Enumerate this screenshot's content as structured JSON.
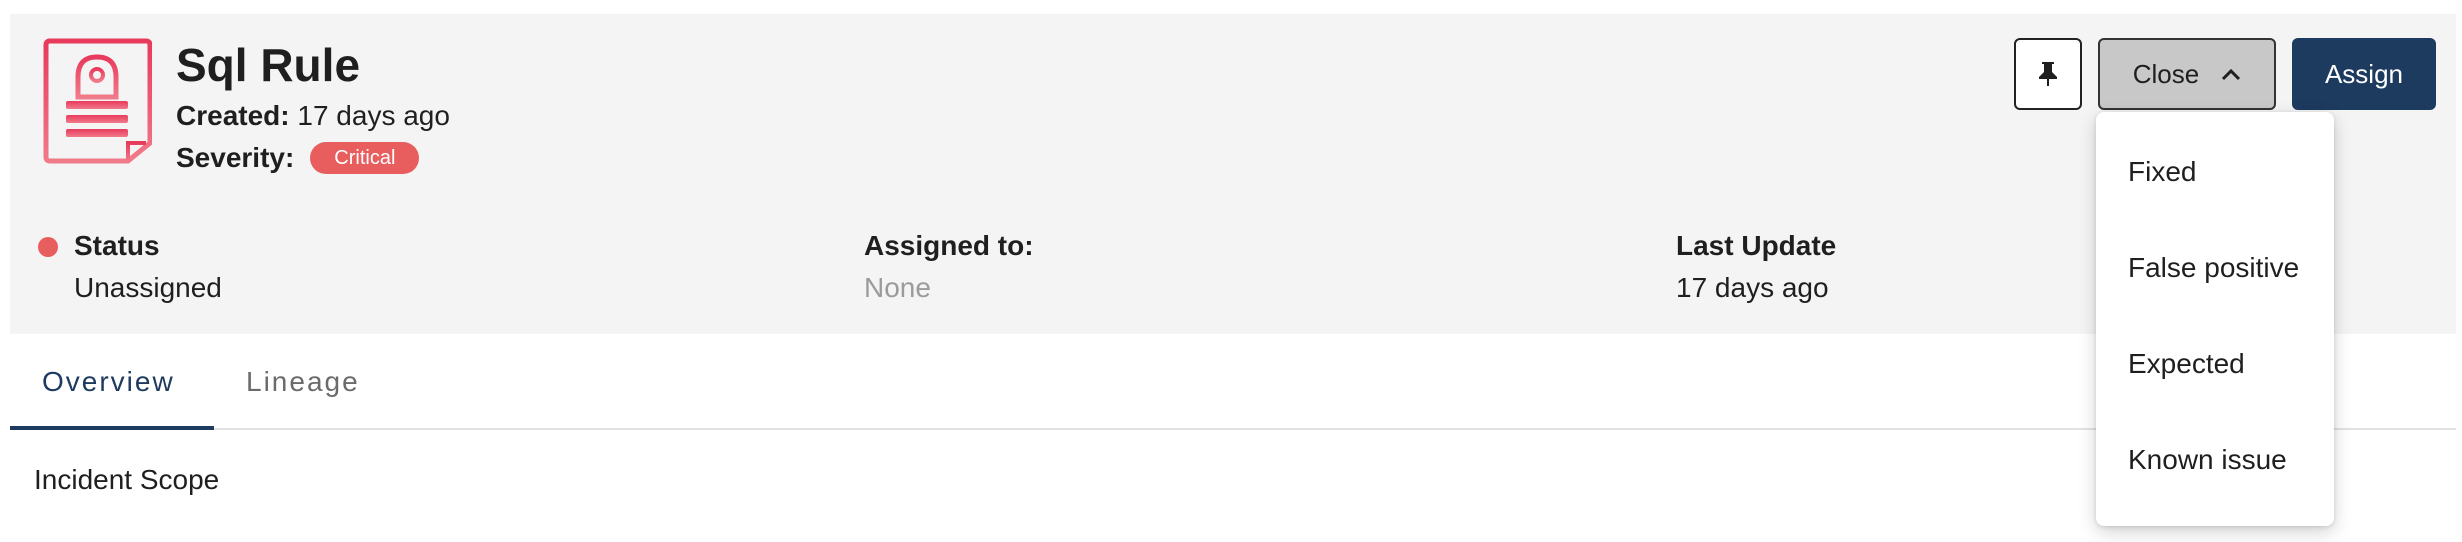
{
  "incident": {
    "title": "Sql Rule",
    "created_label": "Created:",
    "created_value": "17 days ago",
    "severity_label": "Severity:",
    "severity_value": "Critical",
    "icon": "alarm-siren-icon"
  },
  "actions": {
    "pin_icon": "pin-icon",
    "close_label": "Close",
    "close_chevron_icon": "chevron-up-icon",
    "assign_label": "Assign"
  },
  "info": {
    "status_label": "Status",
    "status_value": "Unassigned",
    "assigned_label": "Assigned to:",
    "assigned_value": "None",
    "update_label": "Last Update",
    "update_value": "17 days ago"
  },
  "tabs": [
    {
      "label": "Overview",
      "active": true
    },
    {
      "label": "Lineage",
      "active": false
    }
  ],
  "content": {
    "section_title": "Incident Scope"
  },
  "close_menu": {
    "items": [
      "Fixed",
      "False positive",
      "Expected",
      "Known issue"
    ]
  },
  "colors": {
    "accent": "#1d3a5f",
    "critical": "#e85d5d",
    "header_bg": "#f4f4f4"
  }
}
